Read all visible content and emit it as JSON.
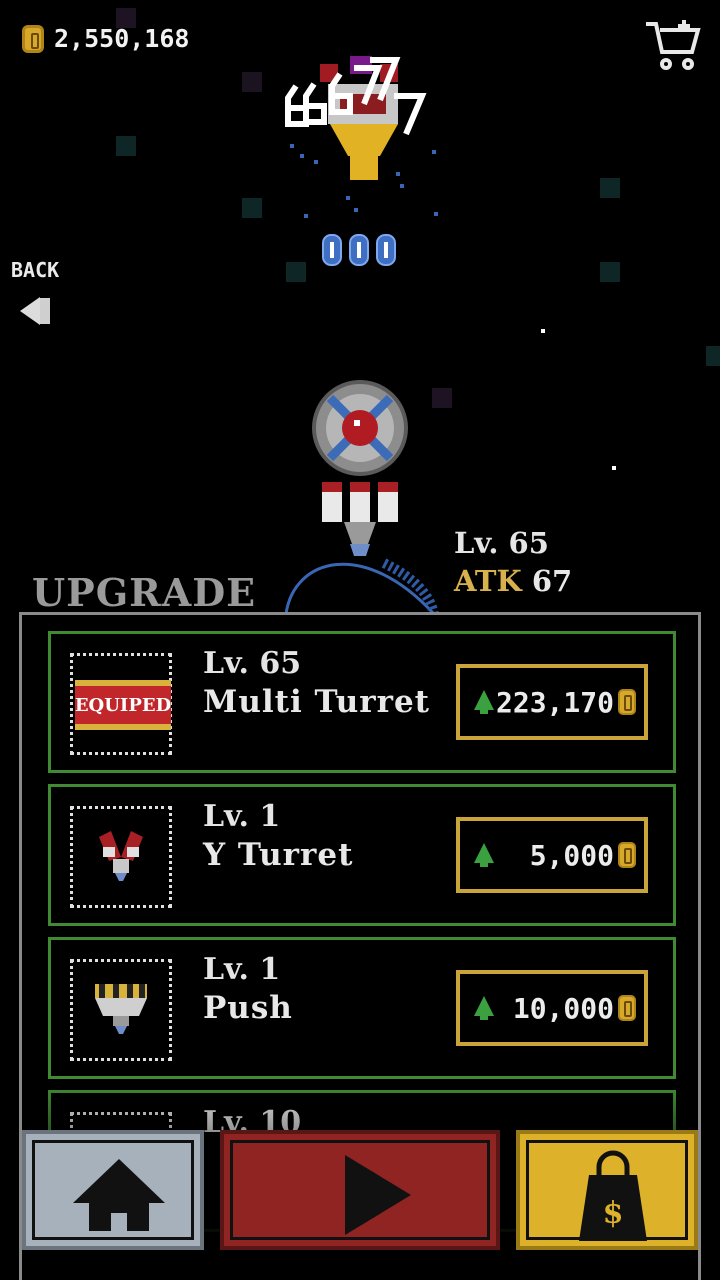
{
  "hud": {
    "coins": "2,550,168",
    "back_label": "BACK"
  },
  "ship": {
    "level": "Lv. 65",
    "atk_key": "ATK",
    "atk_value": "67"
  },
  "upgrade": {
    "title": "UPGRADE",
    "items": [
      {
        "level": "Lv. 65",
        "name": "Multi Turret",
        "price": "223,170",
        "badge": "EQUIPED"
      },
      {
        "level": "Lv. 1",
        "name": "Y Turret",
        "price": "5,000"
      },
      {
        "level": "Lv. 1",
        "name": "Push",
        "price": "10,000"
      },
      {
        "level": "Lv. 10"
      }
    ]
  },
  "colors": {
    "coin": "#d6a92a",
    "item_border": "#3f8a32",
    "price_border": "#c9a43a",
    "home": "#a7b1bb",
    "play": "#8f2422",
    "shop": "#ddb12a"
  },
  "icons": [
    "coin-icon",
    "cart-icon",
    "back-arrow-icon",
    "upgrade-arrow-icon",
    "home-icon",
    "play-icon",
    "shopping-bag-icon"
  ]
}
